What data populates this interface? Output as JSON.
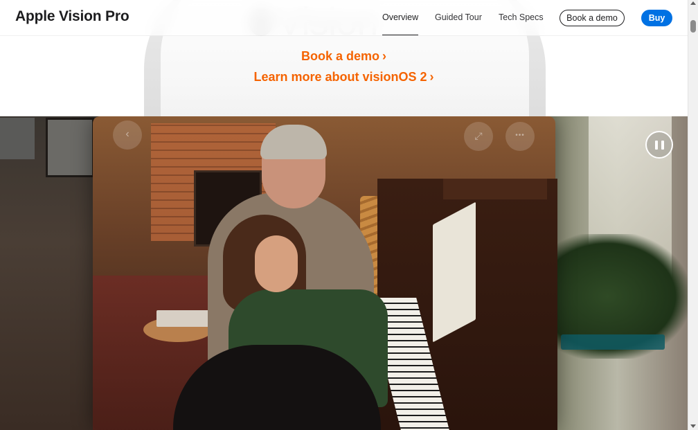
{
  "nav": {
    "title": "Apple Vision Pro",
    "links": [
      {
        "label": "Overview",
        "active": true
      },
      {
        "label": "Guided Tour",
        "active": false
      },
      {
        "label": "Tech Specs",
        "active": false
      }
    ],
    "book_demo_label": "Book a demo",
    "buy_label": "Buy"
  },
  "hero": {
    "background_logo_text": "Vision",
    "links": [
      {
        "label": "Book a demo",
        "chevron": "›"
      },
      {
        "label": "Learn more about visionOS 2",
        "chevron": "›"
      }
    ],
    "link_color": "#f56300"
  },
  "video": {
    "state": "playing",
    "control_icons": [
      "back-chevron-icon",
      "expand-icon",
      "more-icon",
      "pause-icon"
    ],
    "glyphs": {
      "back": "‹",
      "expand": "⤢",
      "more": "•••"
    }
  },
  "colors": {
    "buy_button": "#0071e3",
    "accent_link": "#f56300",
    "text": "#1d1d1f"
  }
}
